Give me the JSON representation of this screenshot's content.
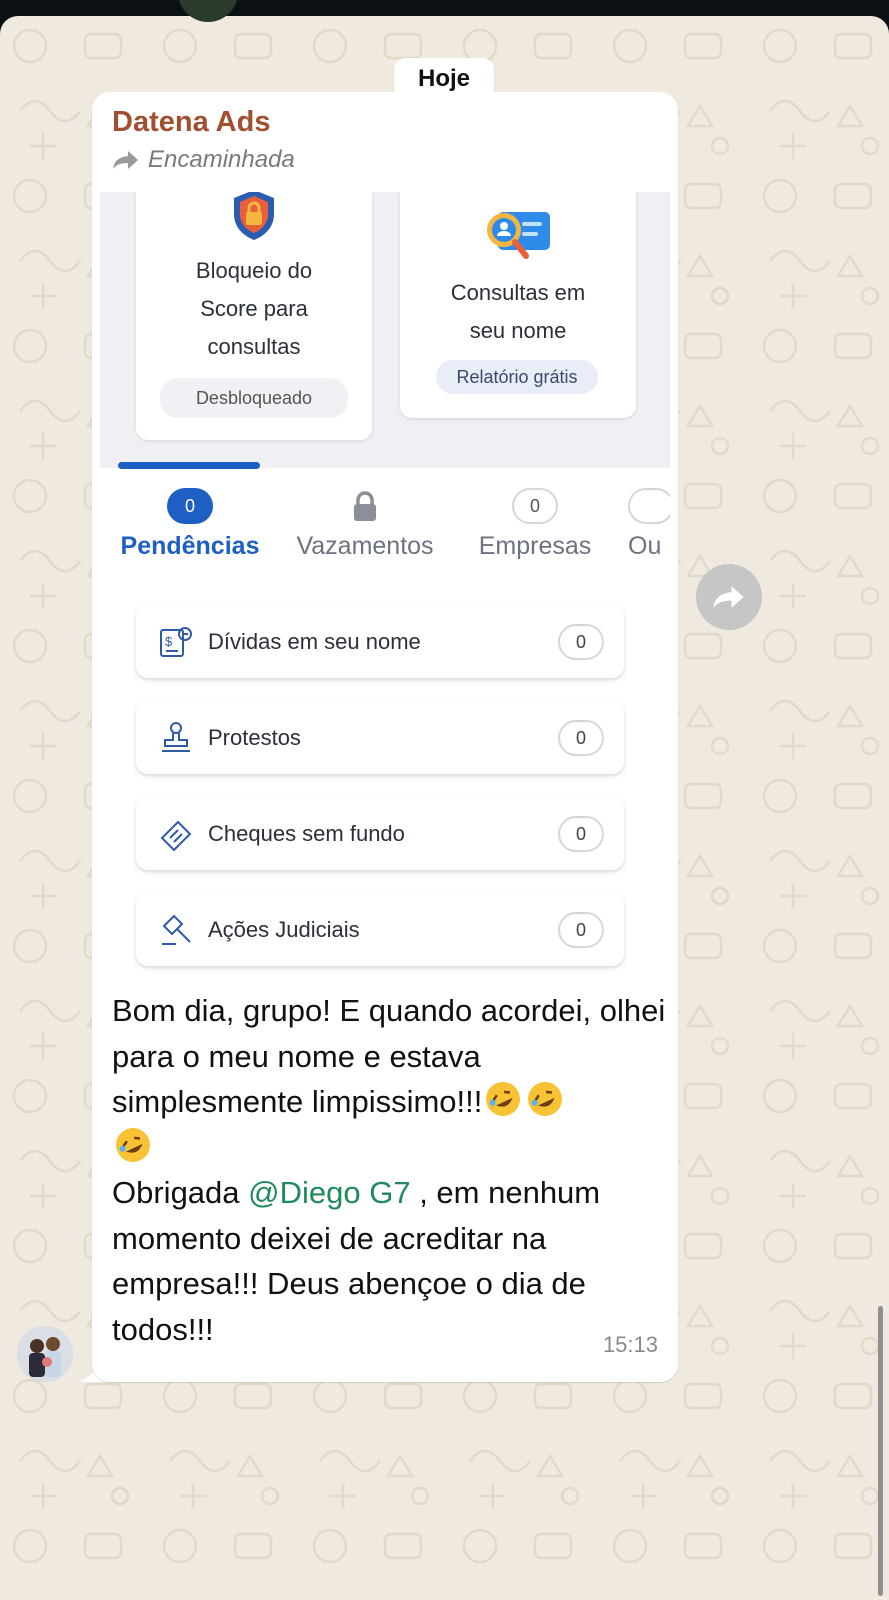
{
  "date_chip": "Hoje",
  "message": {
    "sender": "Datena Ads",
    "forwarded_label": "Encaminhada",
    "time": "15:13",
    "text_line1": "Bom dia, grupo! E quando acordei, olhei para o meu nome e estava simplesmente limpissimo!!!",
    "text_prefix": "Obrigada ",
    "mention": "@Diego G7",
    "text_suffix": " , em nenhum momento deixei de acreditar na empresa!!! Deus abençoe o dia de todos!!!",
    "emoji_count": 3
  },
  "screenshot": {
    "cards": [
      {
        "title": "Bloqueio do Score para consultas",
        "pill": "Desbloqueado",
        "icon": "shield-lock-icon"
      },
      {
        "title": "Consultas em seu nome",
        "pill": "Relatório grátis",
        "icon": "id-search-icon"
      }
    ],
    "tabs": [
      {
        "label": "Pendências",
        "badge": "0",
        "active": true
      },
      {
        "label": "Vazamentos",
        "badge": "",
        "icon": "lock-icon"
      },
      {
        "label": "Empresas",
        "badge": "0"
      },
      {
        "label": "Ou",
        "badge": ""
      }
    ],
    "rows": [
      {
        "label": "Dívidas em seu nome",
        "count": "0",
        "icon": "debt-icon"
      },
      {
        "label": "Protestos",
        "count": "0",
        "icon": "stamp-icon"
      },
      {
        "label": "Cheques sem fundo",
        "count": "0",
        "icon": "check-icon"
      },
      {
        "label": "Ações Judiciais",
        "count": "0",
        "icon": "gavel-icon"
      }
    ]
  },
  "colors": {
    "chat_background": "#efe9df",
    "sender_name": "#a14f2e",
    "mention": "#1f8a5b",
    "accent_blue": "#1e5fc4"
  }
}
